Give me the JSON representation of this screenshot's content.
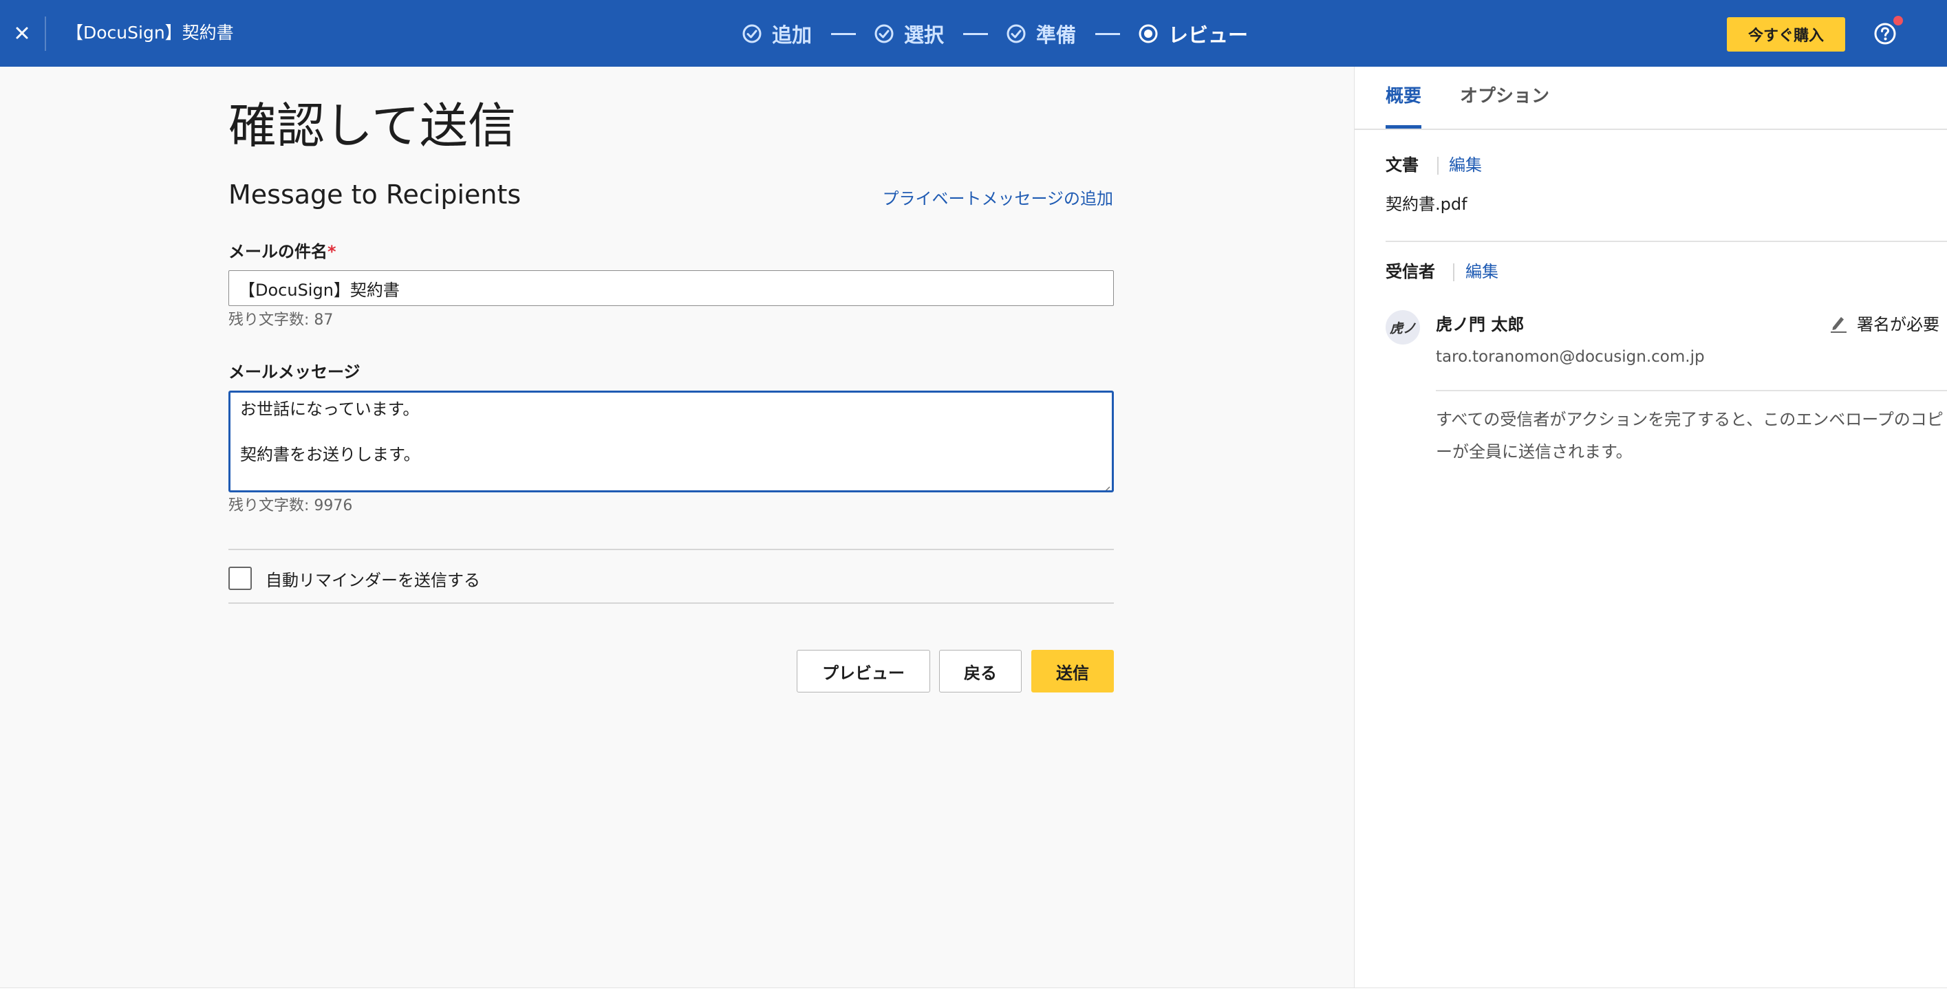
{
  "header": {
    "doc_title": "【DocuSign】契約書",
    "steps": [
      {
        "label": "追加",
        "state": "done"
      },
      {
        "label": "選択",
        "state": "done"
      },
      {
        "label": "準備",
        "state": "done"
      },
      {
        "label": "レビュー",
        "state": "current"
      }
    ],
    "buy_label": "今すぐ購入",
    "icons": {
      "close": "close-icon",
      "step_done": "check-circle-icon",
      "step_current": "radio-dot-icon",
      "help": "help-circle-icon"
    }
  },
  "main": {
    "page_title": "確認して送信",
    "section_title": "Message to Recipients",
    "private_message_link": "プライベートメッセージの追加",
    "subject": {
      "label": "メールの件名",
      "required_mark": "*",
      "value": "【DocuSign】契約書",
      "remaining": "残り文字数: 87"
    },
    "message": {
      "label": "メールメッセージ",
      "lines": [
        "お世話になっています。",
        "",
        "契約書をお送りします。"
      ],
      "remaining": "残り文字数: 9976"
    },
    "reminder": {
      "label": "自動リマインダーを送信する",
      "checked": false
    },
    "buttons": {
      "preview": "プレビュー",
      "back": "戻る",
      "send": "送信"
    }
  },
  "panel": {
    "tabs": [
      {
        "label": "概要",
        "active": true
      },
      {
        "label": "オプション",
        "active": false
      }
    ],
    "documents": {
      "heading": "文書",
      "edit": "編集",
      "files": [
        "契約書.pdf"
      ]
    },
    "recipients": {
      "heading": "受信者",
      "edit": "編集",
      "list": [
        {
          "avatar_text": "虎ノ",
          "name": "虎ノ門 太郎",
          "email": "taro.toranomon@docusign.com.jp",
          "action": "署名が必要",
          "action_icon": "pen-icon"
        }
      ]
    },
    "note": "すべての受信者がアクションを完了すると、このエンベロープのコピーが全員に送信されます。"
  },
  "colors": {
    "brand_blue": "#1f5bb3",
    "accent_yellow": "#ffcc33",
    "notification_red": "#f0525c",
    "required_red": "#e0303c"
  }
}
